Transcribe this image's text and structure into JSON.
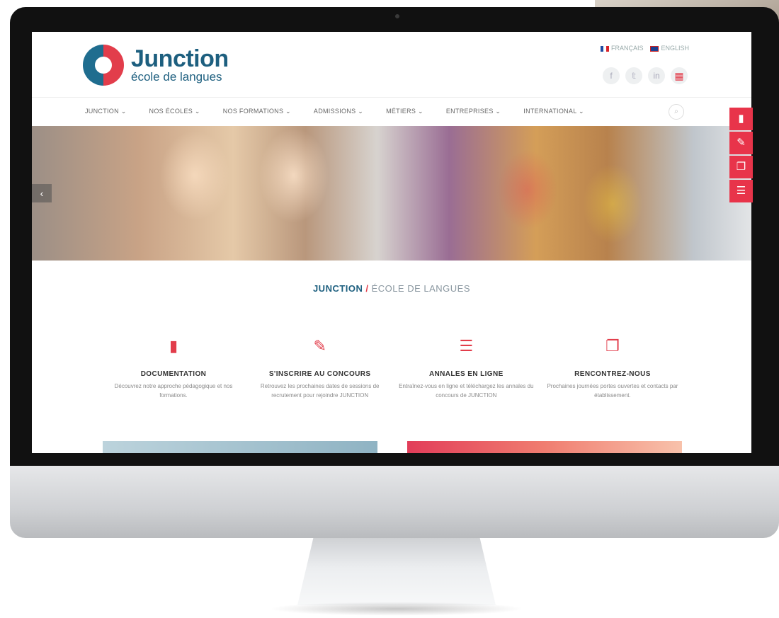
{
  "site": {
    "logo_title": "Junction",
    "logo_subtitle": "école de langues"
  },
  "languages": [
    {
      "label": "FRANÇAIS",
      "flag": "fr"
    },
    {
      "label": "ENGLISH",
      "flag": "en"
    }
  ],
  "social": [
    {
      "name": "facebook-icon",
      "glyph": "f"
    },
    {
      "name": "twitter-icon",
      "glyph": "𝕥"
    },
    {
      "name": "linkedin-icon",
      "glyph": "in"
    },
    {
      "name": "apps-grid-icon",
      "glyph": "▦"
    }
  ],
  "nav": [
    {
      "label": "JUNCTION ⌄"
    },
    {
      "label": "NOS ÉCOLES ⌄"
    },
    {
      "label": "NOS FORMATIONS ⌄"
    },
    {
      "label": "ADMISSIONS ⌄"
    },
    {
      "label": "MÉTIERS ⌄"
    },
    {
      "label": "ENTREPRISES ⌄"
    },
    {
      "label": "INTERNATIONAL ⌄"
    }
  ],
  "hero": {
    "prev_glyph": "‹",
    "next_glyph": "■"
  },
  "side_tabs": [
    {
      "name": "book-icon",
      "glyph": "▮"
    },
    {
      "name": "pencil-icon",
      "glyph": "✎"
    },
    {
      "name": "chat-icon",
      "glyph": "❐"
    },
    {
      "name": "list-icon",
      "glyph": "☰"
    }
  ],
  "section": {
    "brand": "JUNCTION",
    "separator": "/",
    "rest": "ÉCOLE DE LANGUES"
  },
  "features": [
    {
      "icon": "book-icon",
      "glyph": "▮",
      "title": "DOCUMENTATION",
      "desc": "Découvrez notre approche pédagogique et nos formations."
    },
    {
      "icon": "pencil-icon",
      "glyph": "✎",
      "title": "S'INSCRIRE AU CONCOURS",
      "desc": "Retrouvez les prochaines dates de sessions de recrutement pour rejoindre JUNCTION"
    },
    {
      "icon": "list-icon",
      "glyph": "☰",
      "title": "ANNALES EN LIGNE",
      "desc": "Entraînez-vous en ligne et téléchargez les annales du concours de JUNCTION"
    },
    {
      "icon": "chat-icon",
      "glyph": "❐",
      "title": "RENCONTREZ-NOUS",
      "desc": "Prochaines journées portes ouvertes et contacts par établissement."
    }
  ],
  "device": {
    "apple_logo": ""
  }
}
